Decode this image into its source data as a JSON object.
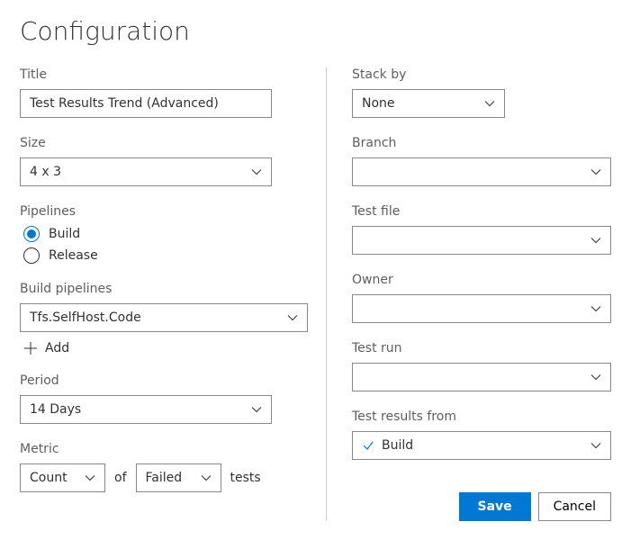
{
  "page_title": "Configuration",
  "left": {
    "title_label": "Title",
    "title_value": "Test Results Trend (Advanced)",
    "size_label": "Size",
    "size_value": "4 x 3",
    "pipelines_label": "Pipelines",
    "pipelines_options": {
      "build": "Build",
      "release": "Release"
    },
    "build_pipelines_label": "Build pipelines",
    "build_pipelines_value": "Tfs.SelfHost.Code",
    "add_label": "Add",
    "period_label": "Period",
    "period_value": "14 Days",
    "metric_label": "Metric",
    "metric_count": "Count",
    "metric_of": "of",
    "metric_failed": "Failed",
    "metric_tests": "tests"
  },
  "right": {
    "stack_by_label": "Stack by",
    "stack_by_value": "None",
    "branch_label": "Branch",
    "branch_value": "",
    "test_file_label": "Test file",
    "test_file_value": "",
    "owner_label": "Owner",
    "owner_value": "",
    "test_run_label": "Test run",
    "test_run_value": "",
    "results_from_label": "Test results from",
    "results_from_value": "Build"
  },
  "buttons": {
    "save": "Save",
    "cancel": "Cancel"
  }
}
